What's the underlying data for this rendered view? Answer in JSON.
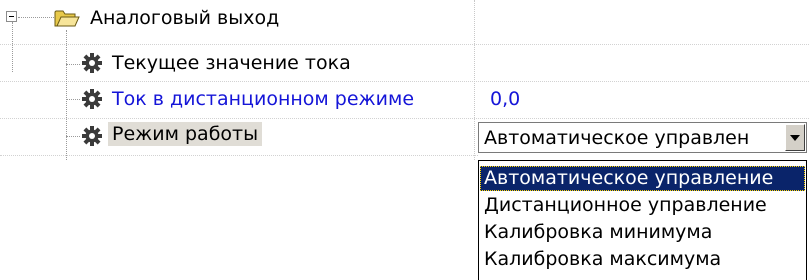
{
  "tree": {
    "group_label": "Аналоговый выход",
    "items": [
      {
        "label": "Текущее значение тока",
        "value": ""
      },
      {
        "label": "Ток в дистанционном режиме",
        "value": "0,0"
      },
      {
        "label": "Режим работы",
        "value": "Автоматическое управлен"
      }
    ]
  },
  "dropdown": {
    "options": [
      "Автоматическое управление",
      "Дистанционное управление",
      "Калибровка минимума",
      "Калибровка максимума"
    ],
    "selected_index": 0
  },
  "colors": {
    "highlight_text": "#1515d8",
    "selection_bg": "#0a246a",
    "row_selected_bg": "#e0ddd6",
    "folder": "#f2d96b"
  },
  "icons": {
    "expander": "minus-box-icon",
    "group": "folder-open-icon",
    "item": "gear-icon"
  }
}
